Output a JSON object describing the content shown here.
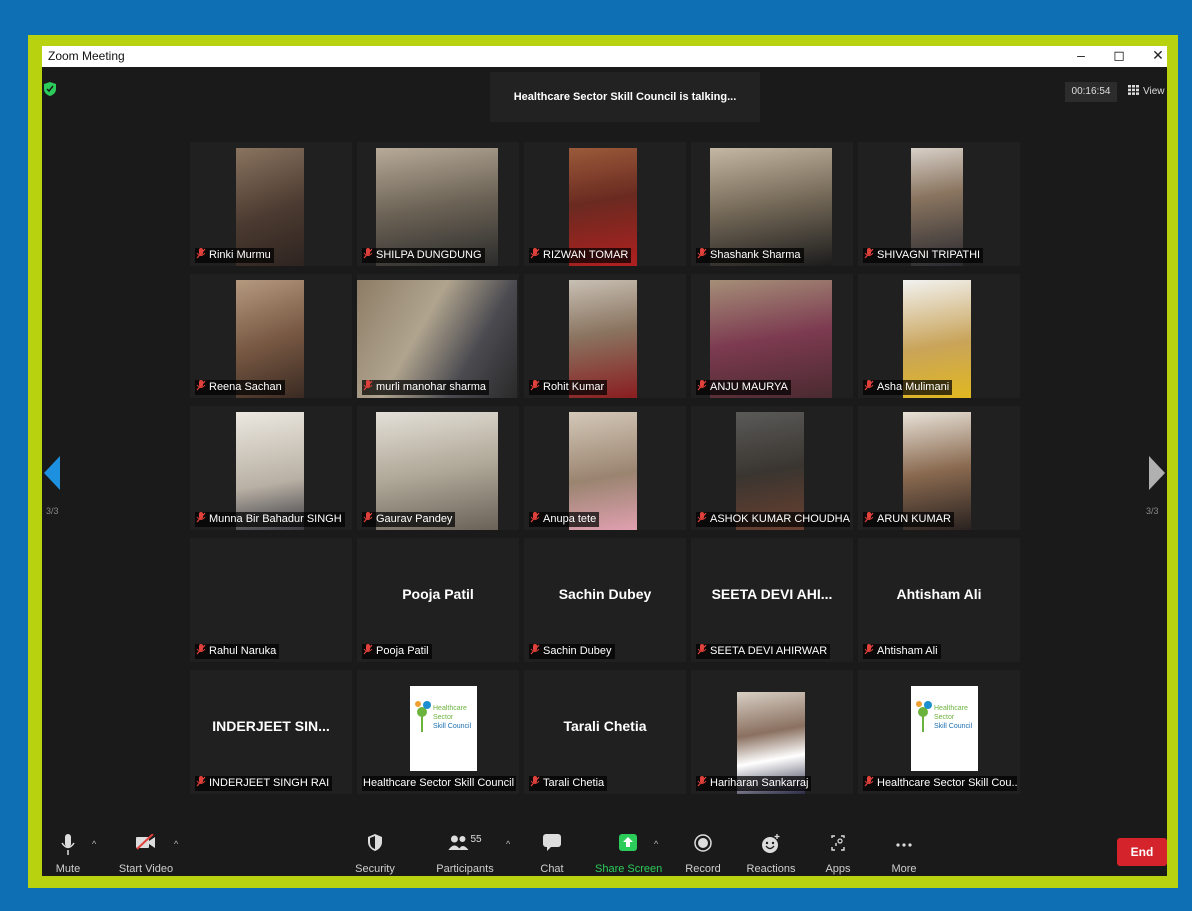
{
  "window": {
    "title": "Zoom Meeting",
    "controls": [
      "–",
      "◻",
      "✕"
    ]
  },
  "talking": "Healthcare Sector Skill Council is talking...",
  "timer": "00:16:54",
  "view_label": "View",
  "page_left": "3/3",
  "page_right": "3/3",
  "participants": [
    {
      "name": "Rinki Murmu",
      "label": ""
    },
    {
      "name": "SHILPA DUNGDUNG",
      "label": ""
    },
    {
      "name": "RIZWAN TOMAR",
      "label": ""
    },
    {
      "name": "Shashank Sharma",
      "label": ""
    },
    {
      "name": "SHIVAGNI TRIPATHI",
      "label": ""
    },
    {
      "name": "Reena Sachan",
      "label": ""
    },
    {
      "name": "murli manohar sharma",
      "label": ""
    },
    {
      "name": "Rohit Kumar",
      "label": ""
    },
    {
      "name": "ANJU MAURYA",
      "label": ""
    },
    {
      "name": "Asha Mulimani",
      "label": ""
    },
    {
      "name": "Munna Bir Bahadur SINGH",
      "label": ""
    },
    {
      "name": "Gaurav Pandey",
      "label": ""
    },
    {
      "name": "Anupa tete",
      "label": ""
    },
    {
      "name": "ASHOK KUMAR CHOUDHA...",
      "label": ""
    },
    {
      "name": "ARUN KUMAR",
      "label": ""
    },
    {
      "name": "Rahul Naruka",
      "label": ""
    },
    {
      "name": "Pooja Patil",
      "label": "Pooja Patil"
    },
    {
      "name": "Sachin Dubey",
      "label": "Sachin Dubey"
    },
    {
      "name": "SEETA DEVI AHIRWAR",
      "label": "SEETA DEVI AHI..."
    },
    {
      "name": "Ahtisham Ali",
      "label": "Ahtisham Ali"
    },
    {
      "name": "INDERJEET SINGH RAI",
      "label": "INDERJEET SIN..."
    },
    {
      "name": "Healthcare Sector Skill Council",
      "label": ""
    },
    {
      "name": "Tarali Chetia",
      "label": "Tarali Chetia"
    },
    {
      "name": "Hariharan Sankarraj",
      "label": ""
    },
    {
      "name": "Healthcare Sector Skill Cou...",
      "label": ""
    }
  ],
  "logo_text": [
    "Healthcare",
    "Sector",
    "Skill Council"
  ],
  "toolbar": {
    "mute": "Mute",
    "start_video": "Start Video",
    "security": "Security",
    "participants": "Participants",
    "participants_count": "55",
    "chat": "Chat",
    "share_screen": "Share Screen",
    "record": "Record",
    "reactions": "Reactions",
    "apps": "Apps",
    "more": "More",
    "end": "End"
  },
  "colors": {
    "outer_background": "#0f6fb5",
    "frame": "#b9d20f",
    "window": "#1a1a1a",
    "share_screen": "#2ccc5a",
    "end": "#d4232b",
    "muted_mic": "#e0413a"
  }
}
